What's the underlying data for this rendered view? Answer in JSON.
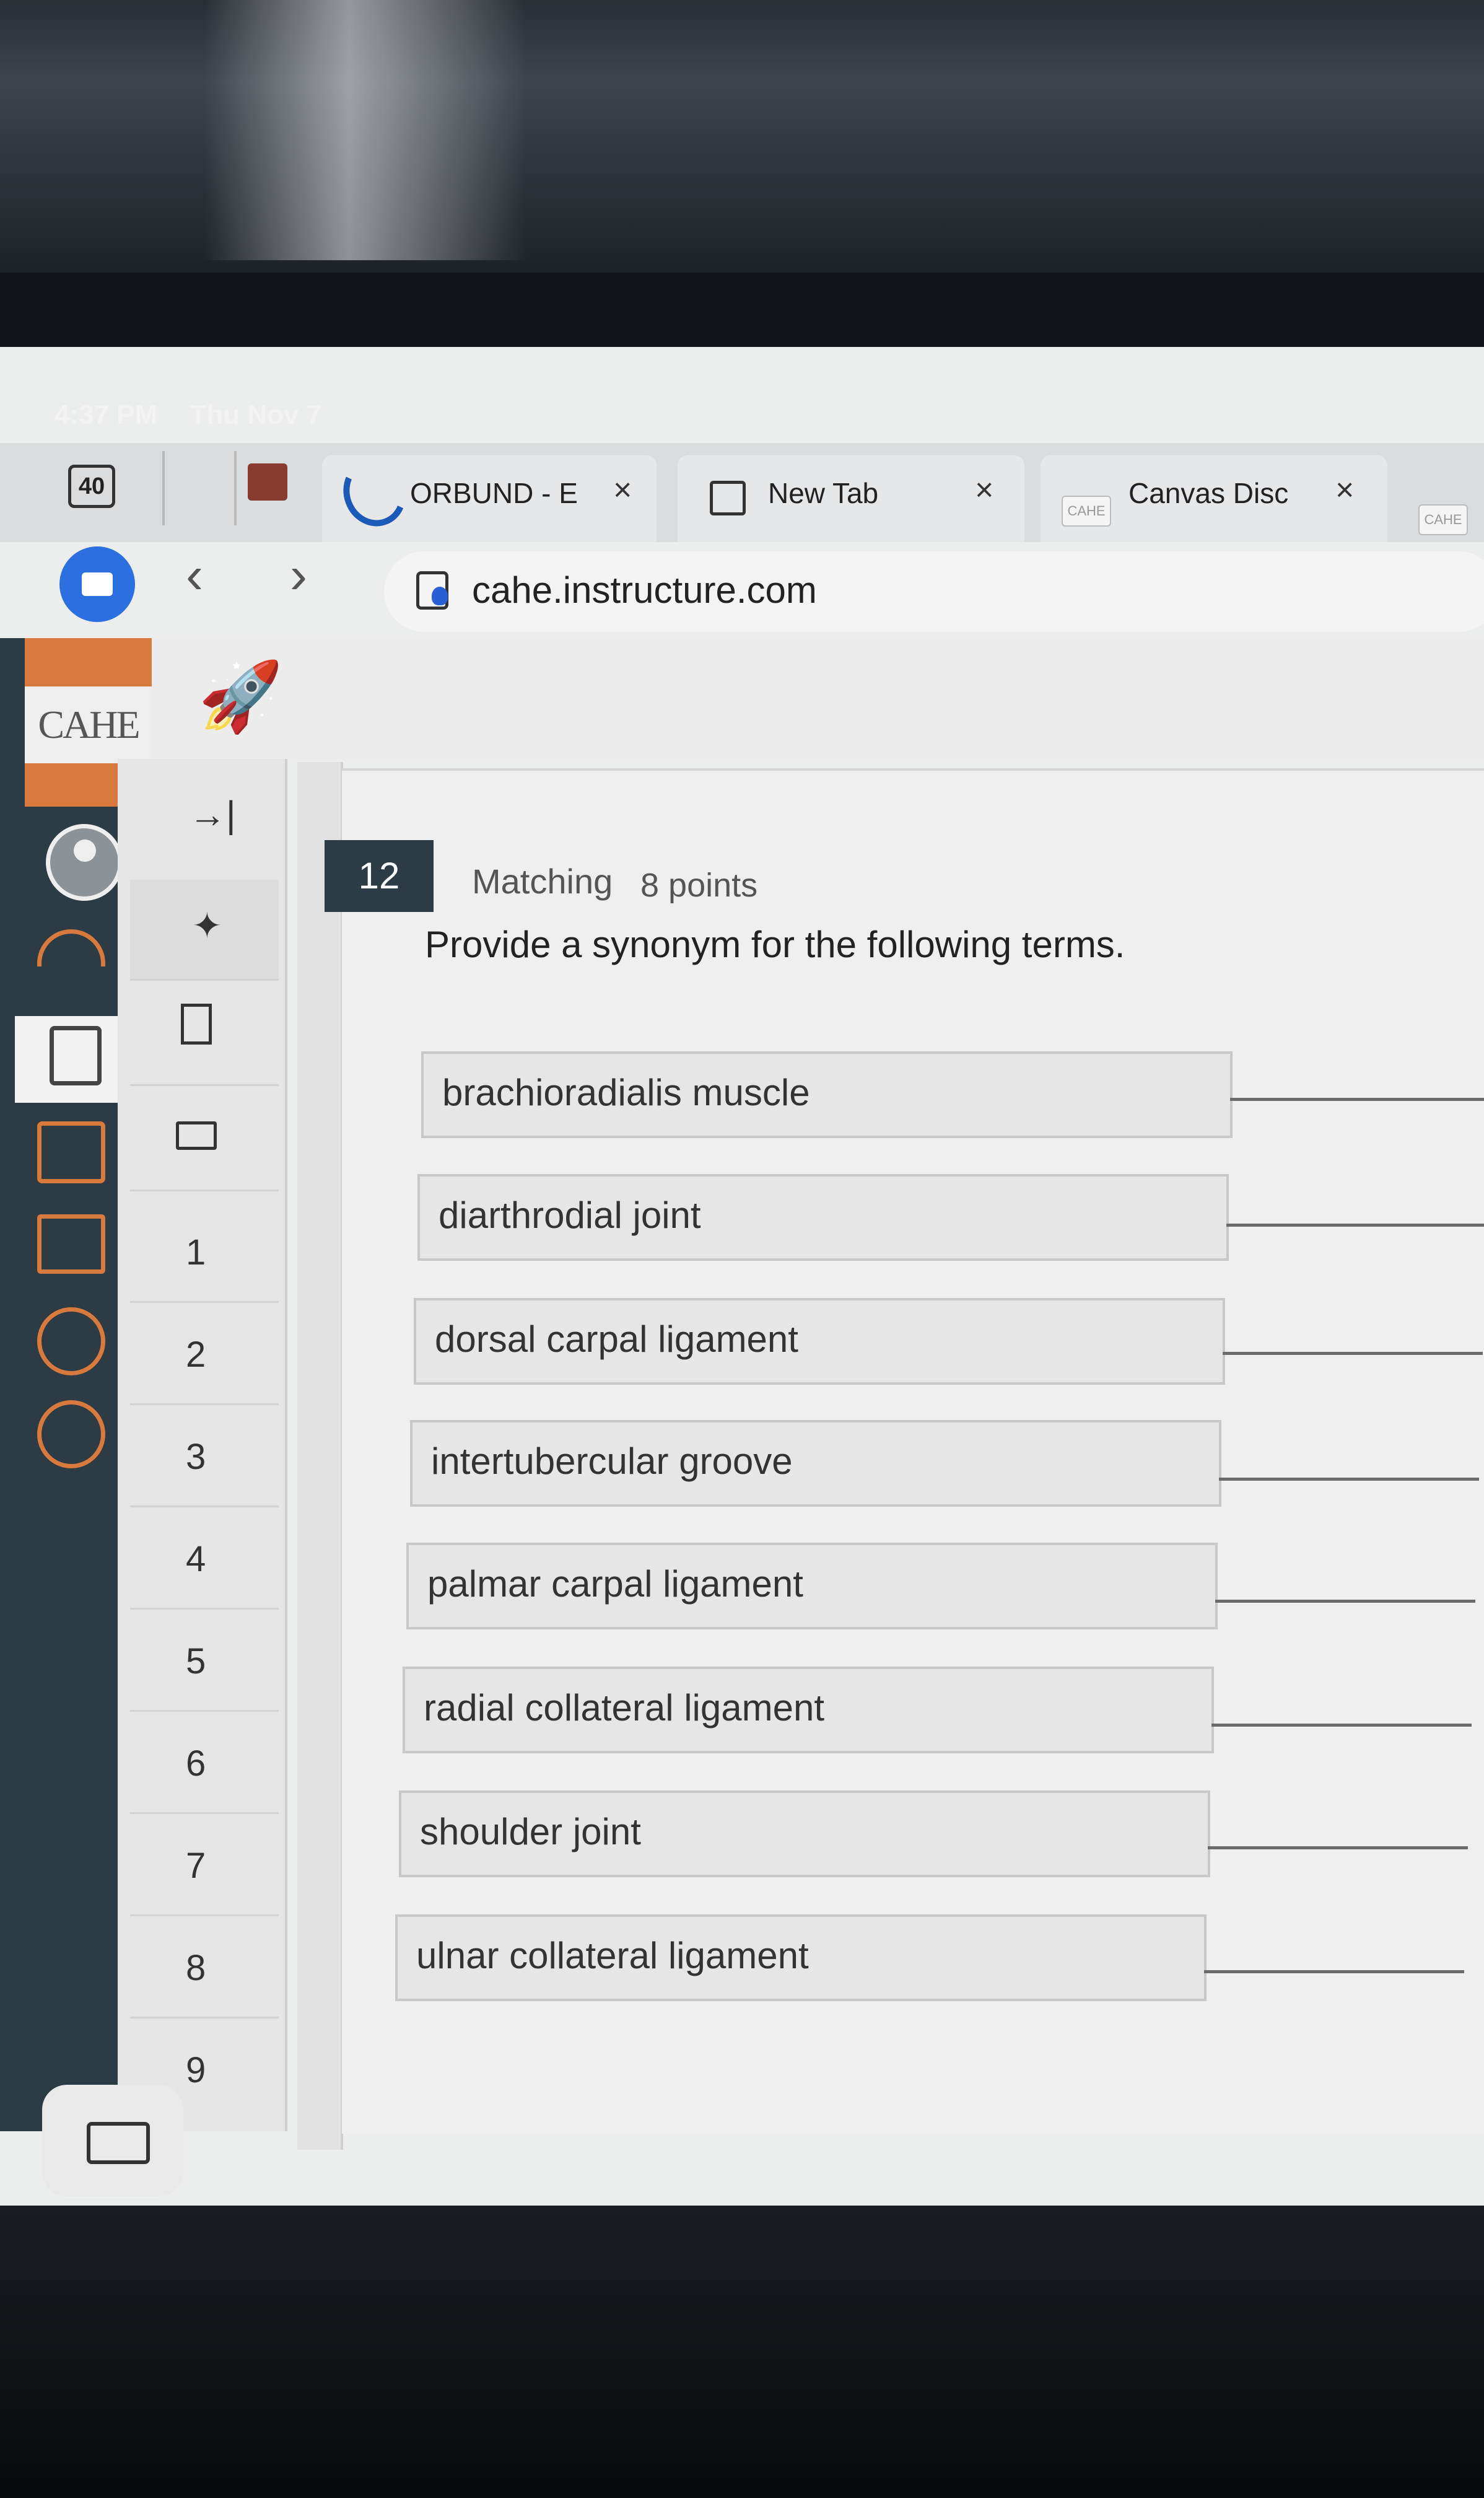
{
  "status_bar": {
    "time": "4:37 PM",
    "date": "Thu Nov 7"
  },
  "tab_bar": {
    "tab_count": "40",
    "tabs": [
      {
        "label": "ORBUND - E",
        "icon": "orbund-swirl-icon"
      },
      {
        "label": "New Tab",
        "icon": "new-tab-icon"
      },
      {
        "label": "Canvas Disc",
        "icon": "cahe-logo-icon"
      }
    ],
    "mini_logo": "CAHE"
  },
  "address_bar": {
    "url": "cahe.instructure.com"
  },
  "global_nav": {
    "logo": "CAHE"
  },
  "question_nav": {
    "items": [
      "1",
      "2",
      "3",
      "4",
      "5",
      "6",
      "7",
      "8",
      "9"
    ]
  },
  "question": {
    "number": "12",
    "type": "Matching",
    "points": "8 points",
    "prompt": "Provide a synonym for the following terms.",
    "terms": [
      "brachioradialis muscle",
      "diarthrodial joint",
      "dorsal carpal ligament",
      "intertubercular groove",
      "palmar carpal ligament",
      "radial collateral ligament",
      "shoulder joint",
      "ulnar collateral ligament"
    ]
  }
}
